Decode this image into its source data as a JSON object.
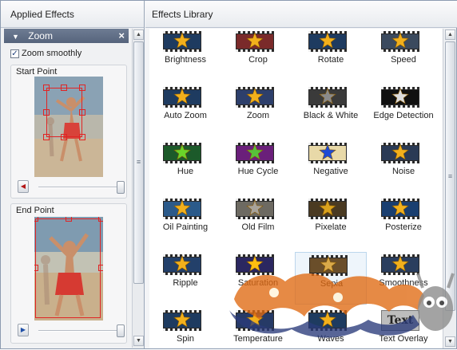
{
  "left_panel": {
    "title": "Applied Effects",
    "effect_bar": {
      "label": "Zoom",
      "close": "×",
      "collapse": "▼"
    },
    "zoom_smoothly": {
      "label": "Zoom smoothly",
      "checked": true,
      "mark": "✓"
    },
    "start_point": {
      "title": "Start Point",
      "slider_button": "◀"
    },
    "end_point": {
      "title": "End Point",
      "slider_button": "▶"
    }
  },
  "library": {
    "title": "Effects Library",
    "effects": [
      {
        "label": "Brightness",
        "bg": "#1e3b60",
        "star": "#f2b01c"
      },
      {
        "label": "Crop",
        "bg": "#7a2a2a",
        "star": "#f2b01c"
      },
      {
        "label": "Rotate",
        "bg": "#1e3b60",
        "star": "#f2b01c"
      },
      {
        "label": "Speed",
        "bg": "#3b4a5e",
        "star": "#f2b01c"
      },
      {
        "label": "Auto Zoom",
        "bg": "#1e3b60",
        "star": "#f2b01c"
      },
      {
        "label": "Zoom",
        "bg": "#2d3f6b",
        "star": "#f2b01c"
      },
      {
        "label": "Black & White",
        "bg": "#3a3a3a",
        "star": "#8a8a8a"
      },
      {
        "label": "Edge Detection",
        "bg": "#111111",
        "star": "#dddddd"
      },
      {
        "label": "Hue",
        "bg": "#1c5a2a",
        "star": "#6ad42a"
      },
      {
        "label": "Hue Cycle",
        "bg": "#6a1f7a",
        "star": "#58c23a"
      },
      {
        "label": "Negative",
        "bg": "#e8d9a8",
        "star": "#1e4bd4"
      },
      {
        "label": "Noise",
        "bg": "#2a3a55",
        "star": "#f2b01c"
      },
      {
        "label": "Oil Painting",
        "bg": "#2b5a8a",
        "star": "#f2b01c"
      },
      {
        "label": "Old Film",
        "bg": "#6d6a62",
        "star": "#a8a39a"
      },
      {
        "label": "Pixelate",
        "bg": "#4a3a22",
        "star": "#d9a21e"
      },
      {
        "label": "Posterize",
        "bg": "#1a3f70",
        "star": "#f2b01c"
      },
      {
        "label": "Ripple",
        "bg": "#23406a",
        "star": "#f2b01c"
      },
      {
        "label": "Saturation",
        "bg": "#2b2760",
        "star": "#ffbf10"
      },
      {
        "label": "Sepia",
        "bg": "#6a4e2a",
        "star": "#d9a94a"
      },
      {
        "label": "Smoothness",
        "bg": "#2a3e5e",
        "star": "#f2b01c"
      },
      {
        "label": "Spin",
        "bg": "#1e3b60",
        "star": "#f2b01c"
      },
      {
        "label": "Temperature",
        "bg": "#263a66",
        "star": "#f2b01c"
      },
      {
        "label": "Waves",
        "bg": "#1e3b60",
        "star": "#f2b01c"
      },
      {
        "label": "Text Overlay",
        "thumb_text": "Text"
      }
    ]
  },
  "scrollbar": {
    "up": "▲",
    "down": "▼",
    "grip": "≡"
  }
}
